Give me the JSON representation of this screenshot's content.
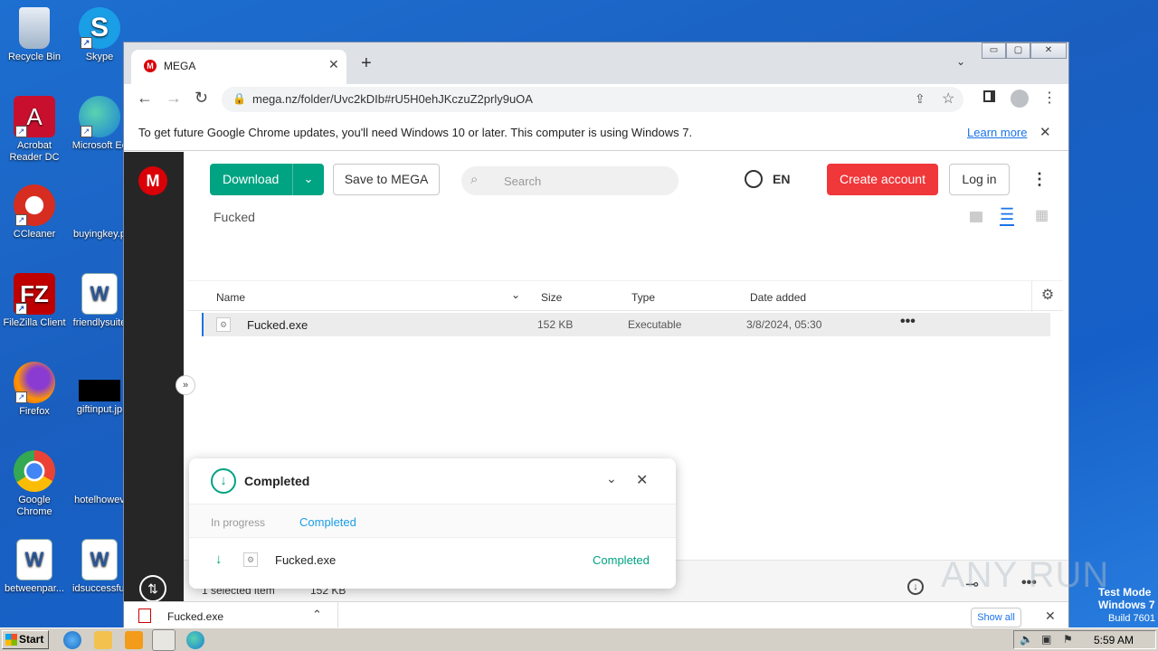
{
  "desktop": {
    "icons": [
      {
        "label": "Recycle Bin"
      },
      {
        "label": "Skype"
      },
      {
        "label": "Acrobat Reader DC"
      },
      {
        "label": "Microsoft Ec"
      },
      {
        "label": "CCleaner"
      },
      {
        "label": "buyingkey.p"
      },
      {
        "label": "FileZilla Client"
      },
      {
        "label": "friendlysuite"
      },
      {
        "label": "Firefox"
      },
      {
        "label": "giftinput.jp"
      },
      {
        "label": "Google Chrome"
      },
      {
        "label": "hotelhowev"
      },
      {
        "label": "betweenpar..."
      },
      {
        "label": "idsuccessful"
      }
    ],
    "watermark": {
      "brand": "ANY RUN",
      "line1": "Test Mode",
      "line2": "Windows 7",
      "line3": "Build 7601"
    }
  },
  "browser": {
    "tab_title": "MEGA",
    "url": "mega.nz/folder/Uvc2kDIb#rU5H0ehJKczuZ2prly9uOA",
    "infobar_text": "To get future Google Chrome updates, you'll need Windows 10 or later. This computer is using Windows 7.",
    "infobar_link": "Learn more",
    "window_controls": {
      "minimize": "▭",
      "maximize": "▢",
      "close": "✕"
    }
  },
  "mega": {
    "download_label": "Download",
    "save_label": "Save to MEGA",
    "search_placeholder": "Search",
    "language": "EN",
    "create_account_label": "Create account",
    "login_label": "Log in",
    "folder_name": "Fucked",
    "columns": {
      "name": "Name",
      "size": "Size",
      "type": "Type",
      "date": "Date added"
    },
    "files": [
      {
        "name": "Fucked.exe",
        "size": "152 KB",
        "type": "Executable",
        "date": "3/8/2024, 05:30"
      }
    ],
    "status": {
      "selected": "1 selected item",
      "size": "152 KB"
    },
    "colors": {
      "accent_green": "#00a382",
      "accent_red": "#f0373a",
      "sidebar": "#262626"
    }
  },
  "transfers": {
    "header": "Completed",
    "tab_in_progress": "In progress",
    "tab_completed": "Completed",
    "item_name": "Fucked.exe",
    "item_status": "Completed"
  },
  "download_shelf": {
    "file_name": "Fucked.exe",
    "show_all": "Show all"
  },
  "taskbar": {
    "start_label": "Start",
    "clock": "5:59 AM"
  }
}
